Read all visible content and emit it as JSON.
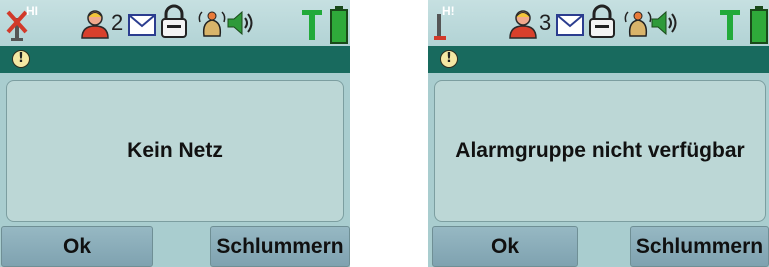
{
  "colors": {
    "screen_bg": "#a9cdcf",
    "title_band": "#186a5e",
    "softkey_bg": "#8fb1bd",
    "battery_green": "#2faa3a",
    "signal_green": "#22aa3a",
    "alarm_red": "#d23a2a"
  },
  "screens": [
    {
      "status": {
        "hi_label": "HI",
        "user_count": "2"
      },
      "dialog": {
        "message": "Kein Netz"
      },
      "softkeys": {
        "left": "Ok",
        "right": "Schlummern"
      },
      "icons": [
        "antenna-crossed-icon",
        "user-icon",
        "mail-icon",
        "lock-icon",
        "alarm-bell-icon",
        "speaker-icon",
        "signal-icon",
        "battery-icon",
        "info-icon"
      ]
    },
    {
      "status": {
        "hi_label": "H!",
        "user_count": "3"
      },
      "dialog": {
        "message": "Alarmgruppe nicht verfügbar"
      },
      "softkeys": {
        "left": "Ok",
        "right": "Schlummern"
      },
      "icons": [
        "antenna-icon",
        "user-icon",
        "mail-icon",
        "lock-icon",
        "alarm-bell-icon",
        "speaker-icon",
        "signal-icon",
        "battery-icon",
        "info-icon"
      ]
    }
  ]
}
